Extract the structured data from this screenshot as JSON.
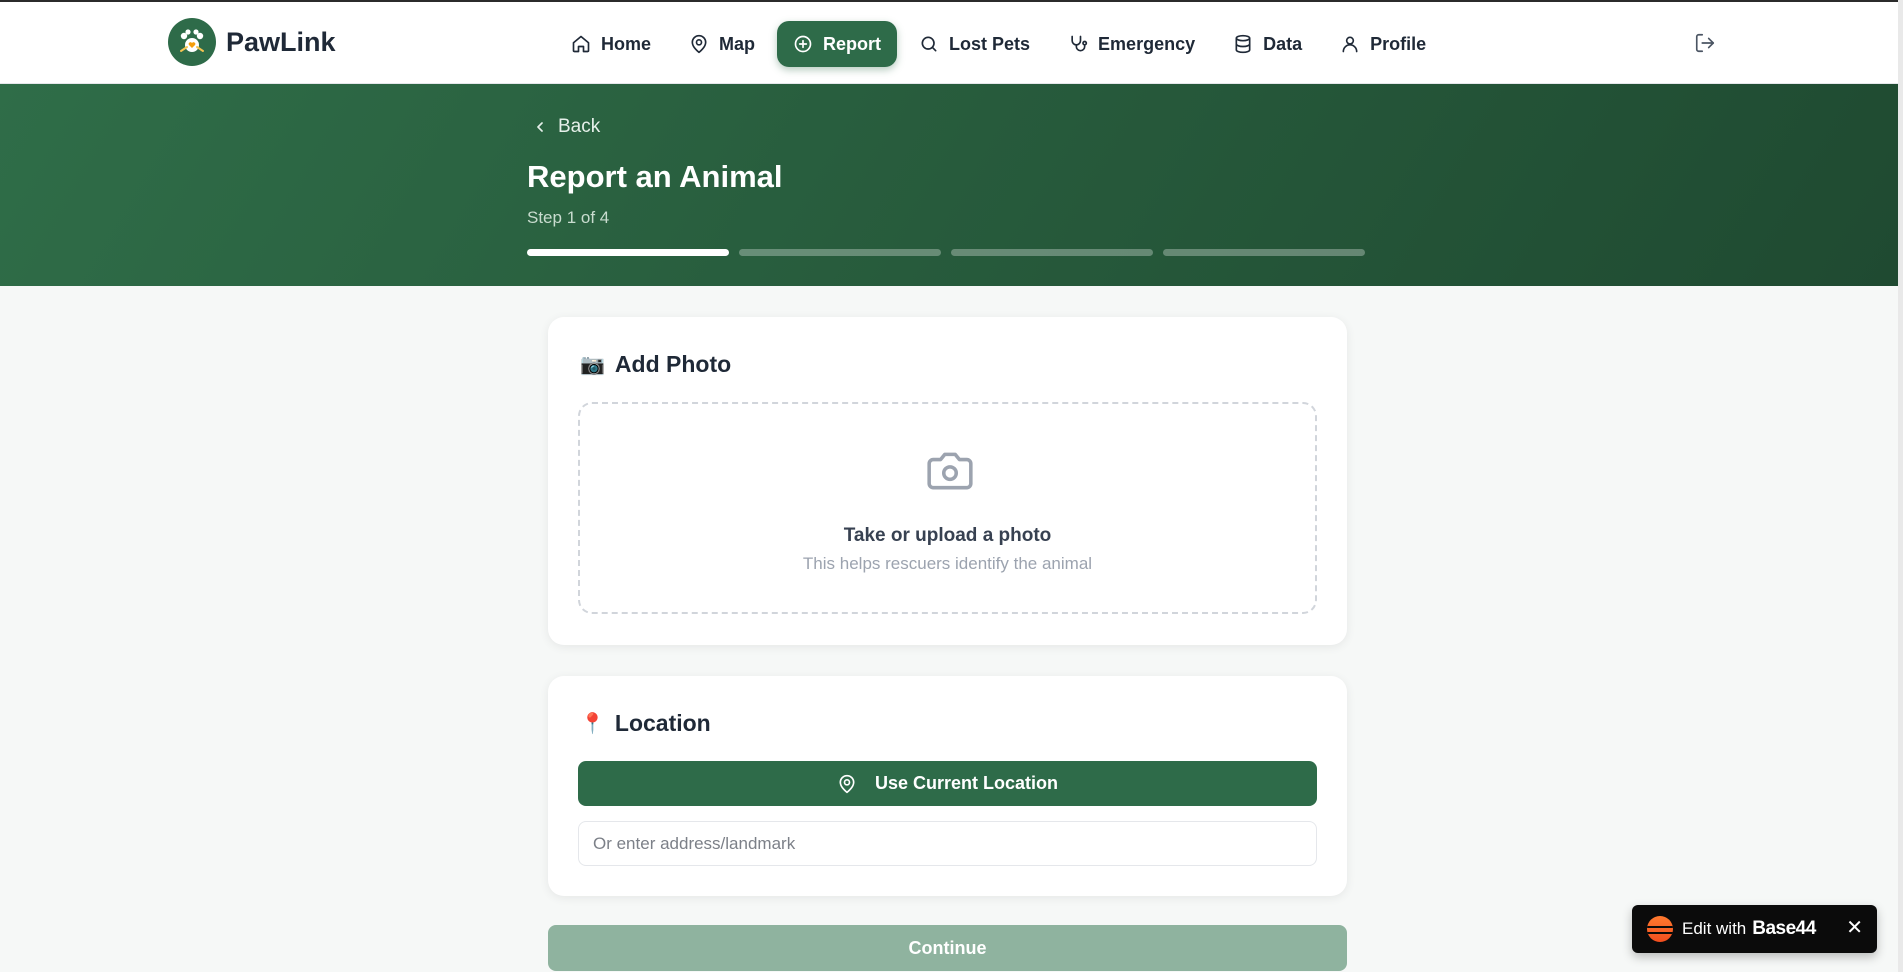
{
  "brand": {
    "name": "PawLink"
  },
  "nav": {
    "items": [
      {
        "label": "Home",
        "icon": "home-icon"
      },
      {
        "label": "Map",
        "icon": "map-pin-icon"
      },
      {
        "label": "Report",
        "icon": "plus-circle-icon",
        "active": true
      },
      {
        "label": "Lost Pets",
        "icon": "search-icon"
      },
      {
        "label": "Emergency",
        "icon": "stethoscope-icon"
      },
      {
        "label": "Data",
        "icon": "database-icon"
      },
      {
        "label": "Profile",
        "icon": "user-icon"
      }
    ],
    "logout_icon": "logout-icon"
  },
  "hero": {
    "back_label": "Back",
    "title": "Report an Animal",
    "step_text": "Step 1 of 4",
    "progress": {
      "current": 1,
      "total": 4
    }
  },
  "photo_card": {
    "emoji": "📷",
    "title": "Add Photo",
    "upload_title": "Take or upload a photo",
    "upload_subtitle": "This helps rescuers identify the animal"
  },
  "location_card": {
    "emoji": "📍",
    "title": "Location",
    "use_current_label": "Use Current Location",
    "address_placeholder": "Or enter address/landmark",
    "address_value": ""
  },
  "continue_label": "Continue",
  "badge": {
    "text": "Edit with",
    "brand": "Base44",
    "close": "✕"
  },
  "colors": {
    "primary": "#2e6b49",
    "primary_disabled": "#8fb39f",
    "hero_dark": "#1f4a31",
    "page_bg": "#f6f8f7"
  }
}
